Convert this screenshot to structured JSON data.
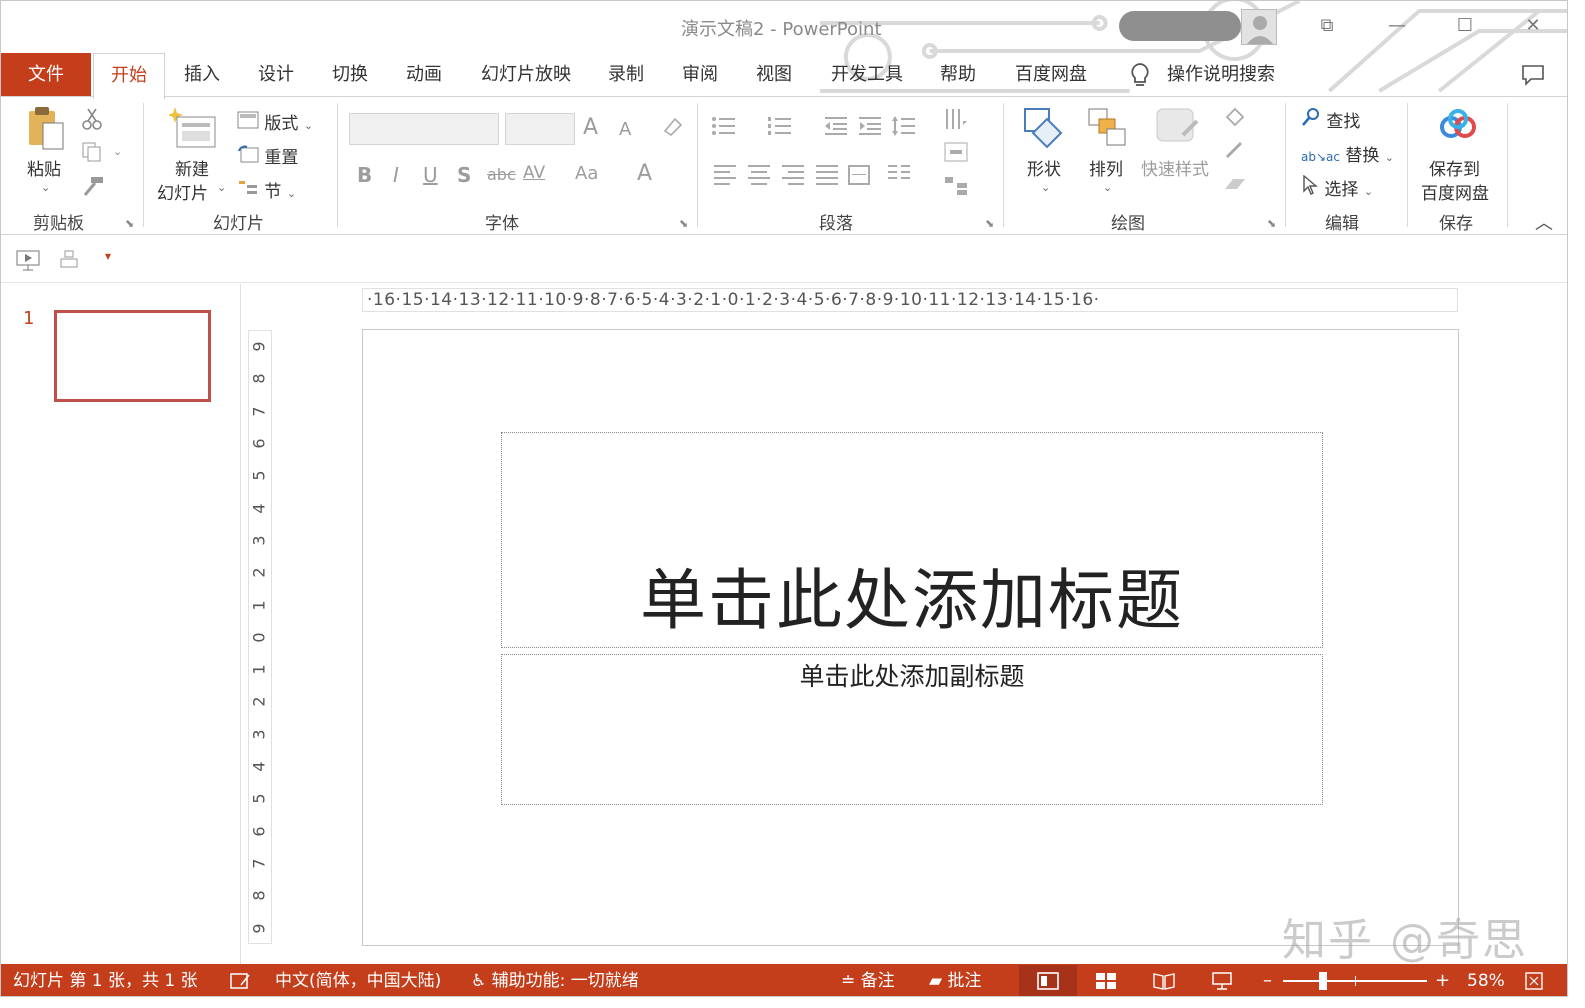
{
  "window": {
    "title": "演示文稿2  -  PowerPoint",
    "restore_symbol": "⧉",
    "minimize_symbol": "—",
    "maximize_symbol": "☐",
    "close_symbol": "✕"
  },
  "tabs": [
    {
      "label": "文件"
    },
    {
      "label": "开始"
    },
    {
      "label": "插入"
    },
    {
      "label": "设计"
    },
    {
      "label": "切换"
    },
    {
      "label": "动画"
    },
    {
      "label": "幻灯片放映"
    },
    {
      "label": "录制"
    },
    {
      "label": "审阅"
    },
    {
      "label": "视图"
    },
    {
      "label": "开发工具"
    },
    {
      "label": "帮助"
    },
    {
      "label": "百度网盘"
    }
  ],
  "tell_me": "操作说明搜索",
  "ribbon": {
    "clipboard": {
      "paste": "粘贴",
      "label": "剪贴板"
    },
    "slides": {
      "new_slide_1": "新建",
      "new_slide_2": "幻灯片",
      "layout": "版式",
      "reset": "重置",
      "section": "节",
      "label": "幻灯片"
    },
    "font": {
      "label": "字体",
      "bold": "B",
      "italic": "I",
      "underline": "U",
      "shadow": "S",
      "strike": "abc",
      "spacing": "AV",
      "case": "Aa",
      "color": "A",
      "grow": "A",
      "shrink": "A"
    },
    "paragraph": {
      "label": "段落"
    },
    "drawing": {
      "shapes": "形状",
      "arrange": "排列",
      "quick_styles": "快速样式",
      "label": "绘图"
    },
    "editing": {
      "find": "查找",
      "replace": "替换",
      "select": "选择",
      "label": "编辑"
    },
    "save": {
      "line1": "保存到",
      "line2": "百度网盘",
      "label": "保存"
    }
  },
  "thumbnails": [
    {
      "number": "1"
    }
  ],
  "hruler_text": "·16·15·14·13·12·11·10·9·8·7·6·5·4·3·2·1·0·1·2·3·4·5·6·7·8·9·10·11·12·13·14·15·16·",
  "vruler_labels": [
    "9",
    "8",
    "7",
    "6",
    "5",
    "4",
    "3",
    "2",
    "1",
    "0",
    "1",
    "2",
    "3",
    "4",
    "5",
    "6",
    "7",
    "8",
    "9"
  ],
  "slide": {
    "title_placeholder": "单击此处添加标题",
    "subtitle_placeholder": "单击此处添加副标题"
  },
  "watermark": "知乎 @奇思",
  "statusbar": {
    "slide_info": "幻灯片 第 1 张，共 1 张",
    "language": "中文(简体，中国大陆)",
    "accessibility": "辅助功能: 一切就绪",
    "notes": "备注",
    "comments": "批注",
    "zoom": "58%"
  },
  "colors": {
    "accent": "#c43e1c",
    "thumb_border": "#c0504d"
  }
}
